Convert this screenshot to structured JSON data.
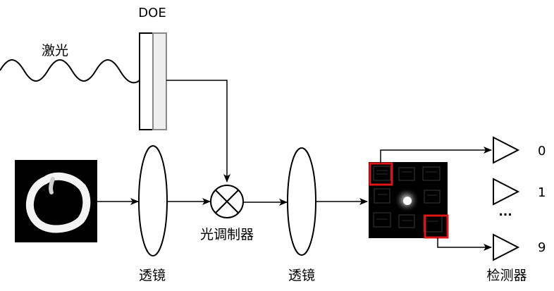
{
  "labels": {
    "doe": "DOE",
    "laser": "激光",
    "lens_1": "透镜",
    "lens_2": "透镜",
    "modulator": "光调制器",
    "detector": "检测器",
    "output_0": "0",
    "output_1": "1",
    "output_ellipsis": "...",
    "output_9": "9"
  },
  "colors": {
    "stroke": "#000000",
    "doe_right_fill": "#eeeeee",
    "doe_right_stroke": "#888888",
    "highlight": "#e01515",
    "image_bg": "#000000"
  },
  "icons": {
    "modulator": "circle-x-icon",
    "detector": "triangle-amplifier-icon"
  }
}
